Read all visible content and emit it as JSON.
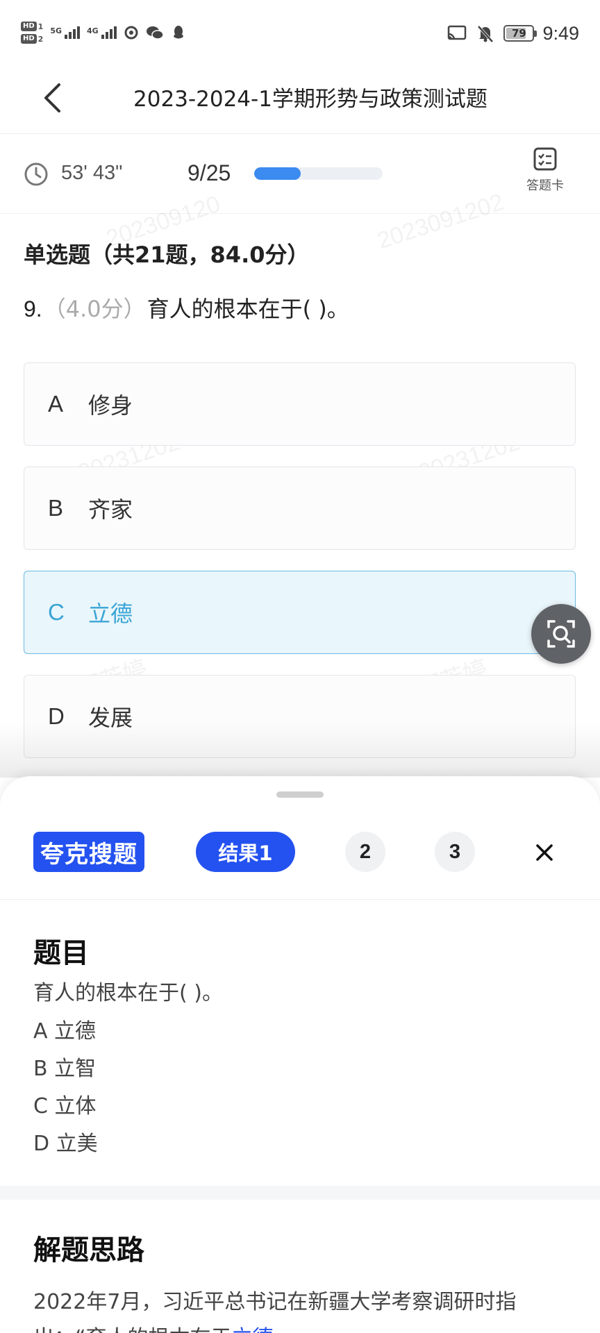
{
  "status_bar": {
    "hd1": "HD",
    "hd1_num": "1",
    "hd2": "HD",
    "hd2_num": "2",
    "sig1": "5G",
    "sig2": "4G",
    "battery": "79",
    "battery_level": 0.79,
    "time": "9:49"
  },
  "header": {
    "title": "2023-2024-1学期形势与政策测试题"
  },
  "progress": {
    "timer": "53' 43\"",
    "current": "9/25",
    "fraction": 0.36,
    "answer_card_label": "答题卡"
  },
  "watermarks": [
    "202309120",
    "2023091202",
    "20231202",
    "20231202",
    "郭芳婷",
    "郭芳婷"
  ],
  "question": {
    "section_title": "单选题（共21题，84.0分）",
    "number": "9.",
    "score": "（4.0分）",
    "stem": "育人的根本在于( )。",
    "options": [
      {
        "letter": "A",
        "text": "修身"
      },
      {
        "letter": "B",
        "text": "齐家"
      },
      {
        "letter": "C",
        "text": "立德"
      },
      {
        "letter": "D",
        "text": "发展"
      }
    ],
    "selected": "C"
  },
  "search_panel": {
    "brand": "夸克搜题",
    "tabs": [
      "结果1",
      "2",
      "3"
    ],
    "close_symbol": "×",
    "question_heading": "题目",
    "question_text": "育人的根本在于( )。",
    "options": [
      "A 立德",
      "B 立智",
      "C 立体",
      "D 立美"
    ],
    "analysis_heading": "解题思路",
    "analysis_line1": "2022年7月，习近平总书记在新疆大学考察调研时指",
    "analysis_line2_prefix": "出：“育人的根本在于",
    "analysis_line2_highlight": "立德"
  },
  "colors": {
    "accent": "#2452f0",
    "selected_text": "#3aa4d6",
    "selected_bg": "#e9f6fb",
    "progress": "#3b8bf0"
  }
}
